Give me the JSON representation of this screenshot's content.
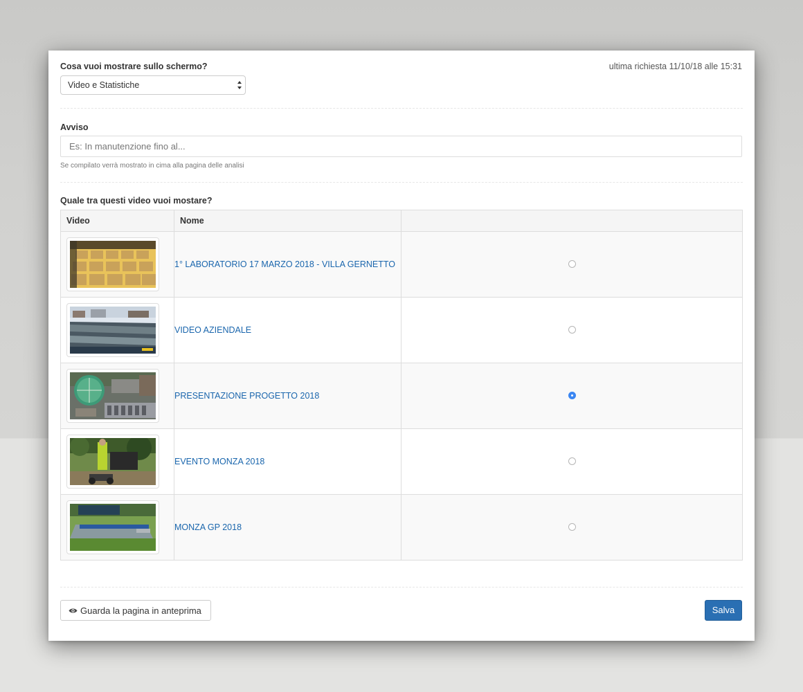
{
  "screen_question": {
    "label": "Cosa vuoi mostrare sullo schermo?",
    "selected": "Video e Statistiche"
  },
  "last_request": "ultima richiesta 11/10/18 alle 15:31",
  "notice": {
    "label": "Avviso",
    "placeholder": "Es: In manutenzione fino al...",
    "help": "Se compilato verrà mostrato in cima alla pagina delle analisi"
  },
  "video_question": "Quale tra questi video vuoi mostare?",
  "table": {
    "headers": [
      "Video",
      "Nome",
      ""
    ],
    "rows": [
      {
        "name": "1° LABORATORIO 17 MARZO 2018 - VILLA GERNETTO",
        "selected": false
      },
      {
        "name": "VIDEO AZIENDALE",
        "selected": false
      },
      {
        "name": "PRESENTAZIONE PROGETTO 2018",
        "selected": true
      },
      {
        "name": "EVENTO MONZA 2018",
        "selected": false
      },
      {
        "name": "MONZA GP 2018",
        "selected": false
      }
    ]
  },
  "buttons": {
    "preview": "Guarda la pagina in anteprima",
    "save": "Salva"
  },
  "colors": {
    "link": "#1a66ad",
    "primary": "#2a6fb3",
    "radio_selected": "#3b86f2"
  },
  "icons": {
    "preview": "eye-icon",
    "select": "select-arrows-icon"
  }
}
